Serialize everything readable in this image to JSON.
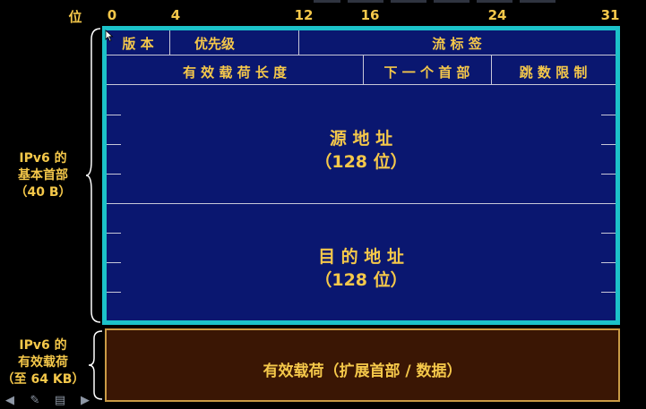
{
  "bit_axis": {
    "label": "位",
    "ticks": [
      "0",
      "4",
      "12",
      "16",
      "24",
      "31"
    ]
  },
  "header": {
    "row1": {
      "version": "版 本",
      "traffic_class": "优先级",
      "flow_label": "流   标   签"
    },
    "row2": {
      "payload_length": "有 效 载 荷 长 度",
      "next_header": "下 一 个 首 部",
      "hop_limit": "跳 数 限 制"
    },
    "source": {
      "title": "源 地 址",
      "size": "（128 位）"
    },
    "destination": {
      "title": "目 的 地 址",
      "size": "（128 位）"
    }
  },
  "payload": {
    "label": "有效载荷（扩展首部 / 数据）"
  },
  "side_labels": {
    "header": [
      "IPv6 的",
      "基本首部",
      "（40 B）"
    ],
    "payload": [
      "IPv6 的",
      "有效载荷",
      "（至 64 KB）"
    ]
  },
  "colors": {
    "header_fill": "#0a1770",
    "header_border": "#1cc2c9",
    "payload_fill": "#3a1604",
    "payload_border": "#c99a45",
    "text": "#f5c84a",
    "grid_line": "#c8c8d8"
  },
  "toolbar_icons": [
    "arrow-left-icon",
    "pencil-icon",
    "menu-icon",
    "arrow-right-icon"
  ]
}
